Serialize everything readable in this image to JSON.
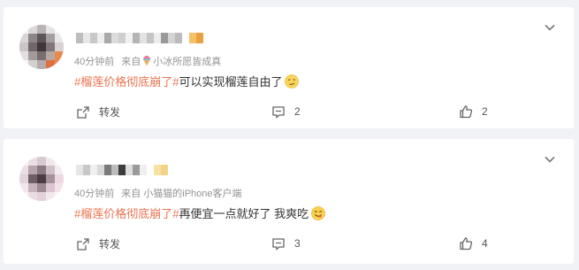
{
  "colors": {
    "topic": "#eb7350",
    "meta": "#939393",
    "text": "#333333",
    "page_bg": "#f1f2f5"
  },
  "posts": [
    {
      "time": "40分钟前",
      "source_prefix": "来自",
      "source_name": "小冰所愿皆成真",
      "topic": "#榴莲价格彻底崩了#",
      "text": "可以实现榴莲自由了",
      "emoji": "smirk-face-emoji",
      "share_label": "转发",
      "comments": "2",
      "likes": "2"
    },
    {
      "time": "40分钟前",
      "source_prefix": "来自",
      "source_name": "小猫猫的iPhone客户端",
      "topic": "#榴莲价格彻底崩了#",
      "text": "再便宜一点就好了 我爽吃",
      "emoji": "yum-face-emoji",
      "share_label": "转发",
      "comments": "3",
      "likes": "4"
    }
  ]
}
